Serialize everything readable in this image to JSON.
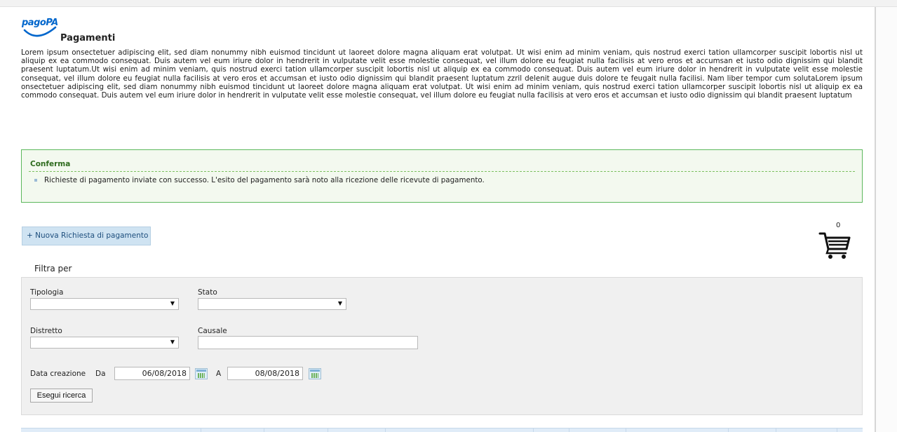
{
  "brand": {
    "logo_text": "pagoPA",
    "primary_color": "#0066cc"
  },
  "page": {
    "title": "Pagamenti",
    "intro_text": "Lorem ipsum onsectetuer adipiscing elit, sed diam nonummy nibh euismod tincidunt ut laoreet dolore magna aliquam erat volutpat. Ut wisi enim ad minim veniam, quis nostrud exerci tation ullamcorper suscipit lobortis nisl ut aliquip ex ea commodo consequat. Duis autem vel eum iriure dolor in hendrerit in vulputate velit esse molestie consequat, vel illum dolore eu feugiat nulla facilisis at vero eros et accumsan et iusto odio dignissim qui blandit praesent luptatum.Ut wisi enim ad minim veniam, quis nostrud exerci tation ullamcorper suscipit lobortis nisl ut aliquip ex ea commodo consequat. Duis autem vel eum iriure dolor in hendrerit in vulputate velit esse molestie consequat, vel illum dolore eu feugiat nulla facilisis at vero eros et accumsan et iusto odio dignissim qui blandit praesent luptatum zzril delenit augue duis dolore te feugait nulla facilisi. Nam liber tempor cum solutaLorem ipsum onsectetuer adipiscing elit, sed diam nonummy nibh euismod tincidunt ut laoreet dolore magna aliquam erat volutpat. Ut wisi enim ad minim veniam, quis nostrud exerci tation ullamcorper suscipit lobortis nisl ut aliquip ex ea commodo consequat. Duis autem vel eum iriure dolor in hendrerit in vulputate velit esse molestie consequat, vel illum dolore eu feugiat nulla facilisis at vero eros et accumsan et iusto odio dignissim qui blandit praesent luptatum"
  },
  "confirm": {
    "title": "Conferma",
    "message": "Richieste di pagamento inviate con successo. L'esito del pagamento sarà noto alla ricezione delle ricevute di pagamento.",
    "border_color": "#5cb85c",
    "background_color": "#f3f9ef"
  },
  "actions": {
    "new_request_label": "+ Nuova Richiesta di pagamento"
  },
  "cart": {
    "count": "0",
    "icon": "shopping-cart-icon"
  },
  "filters": {
    "title": "Filtra per",
    "tipologia": {
      "label": "Tipologia",
      "value": ""
    },
    "stato": {
      "label": "Stato",
      "value": ""
    },
    "distretto": {
      "label": "Distretto",
      "value": ""
    },
    "causale": {
      "label": "Causale",
      "value": ""
    },
    "data_creazione": {
      "label": "Data creazione",
      "from_label": "Da",
      "from_value": "06/08/2018",
      "to_label": "A",
      "to_value": "08/08/2018",
      "icon": "calendar-icon"
    },
    "search_label": "Esegui ricerca"
  }
}
